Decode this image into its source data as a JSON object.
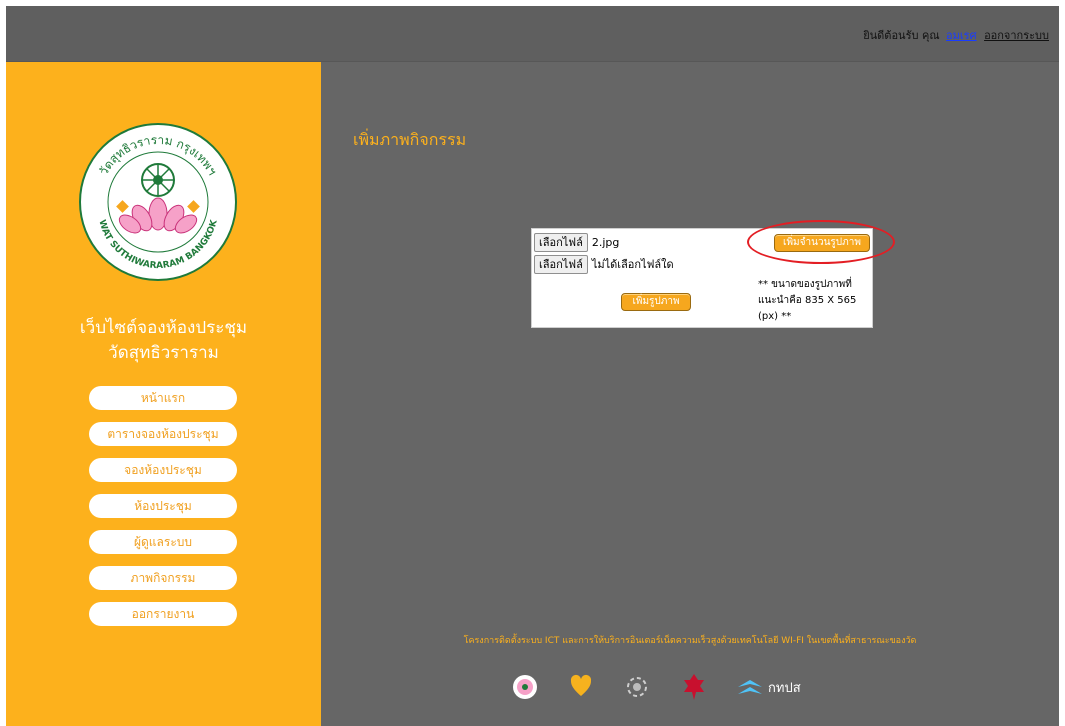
{
  "header": {
    "welcome": "ยินดีต้อนรับ คุณ",
    "username": "อมเรศ",
    "logout": "ออกจากระบบ"
  },
  "sidebar": {
    "logo_text": {
      "top": "วัดสุทธิวราราม กรุงเทพฯ",
      "bottom": "WAT SUTHIWARARAM BANGKOK"
    },
    "site_title_line1": "เว็บไซต์จองห้องประชุม",
    "site_title_line2": "วัดสุทธิวราราม",
    "menu": [
      {
        "label": "หน้าแรก"
      },
      {
        "label": "ตารางจองห้องประชุม"
      },
      {
        "label": "จองห้องประชุม"
      },
      {
        "label": "ห้องประชุม"
      },
      {
        "label": "ผู้ดูแลระบบ"
      },
      {
        "label": "ภาพกิจกรรม"
      },
      {
        "label": "ออกรายงาน"
      }
    ]
  },
  "main": {
    "title": "เพิ่มภาพกิจกรรม",
    "upload": {
      "file_button": "เลือกไฟล์",
      "file1_name": "2.jpg",
      "file2_name": "ไม่ได้เลือกไฟล์ใด",
      "add_count_button": "เพิ่มจำนวนรูปภาพ",
      "add_image_button": "เพิ่มรูปภาพ",
      "size_note": "** ขนาดของรูปภาพที่แนะนำคือ 835 X 565 (px) **"
    }
  },
  "footer": {
    "text": "โครงการติดตั้งระบบ ICT และการให้บริการอินเตอร์เน็ตความเร็วสูงด้วยเทคโนโลยี WI-FI ในเขตพื้นที่สาธารณะของวัด",
    "partner_label": "กทปส",
    "logos": [
      "temple-logo",
      "heart-logo",
      "swirl-logo",
      "garuda-logo",
      "ktps-logo"
    ]
  },
  "colors": {
    "accent": "#fdb11c",
    "background": "#666666",
    "highlight": "#e31e24"
  }
}
